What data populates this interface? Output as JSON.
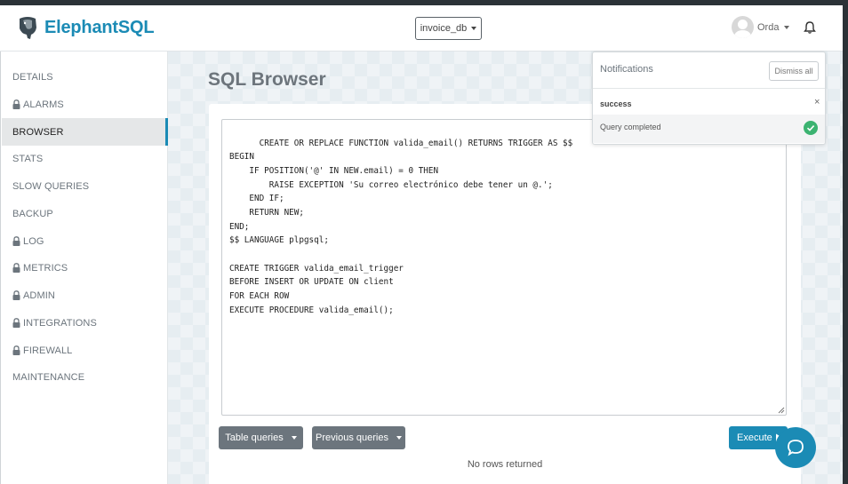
{
  "app": {
    "name": "ElephantSQL"
  },
  "header": {
    "database": "invoice_db",
    "user": "Orda"
  },
  "sidebar": {
    "items": [
      {
        "label": "DETAILS",
        "locked": false,
        "active": false
      },
      {
        "label": "ALARMS",
        "locked": true,
        "active": false
      },
      {
        "label": "BROWSER",
        "locked": false,
        "active": true
      },
      {
        "label": "STATS",
        "locked": false,
        "active": false
      },
      {
        "label": "SLOW QUERIES",
        "locked": false,
        "active": false
      },
      {
        "label": "BACKUP",
        "locked": false,
        "active": false
      },
      {
        "label": "LOG",
        "locked": true,
        "active": false
      },
      {
        "label": "METRICS",
        "locked": true,
        "active": false
      },
      {
        "label": "ADMIN",
        "locked": true,
        "active": false
      },
      {
        "label": "INTEGRATIONS",
        "locked": true,
        "active": false
      },
      {
        "label": "FIREWALL",
        "locked": true,
        "active": false
      },
      {
        "label": "MAINTENANCE",
        "locked": false,
        "active": false
      }
    ]
  },
  "main": {
    "title": "SQL Browser",
    "query": "CREATE OR REPLACE FUNCTION valida_email() RETURNS TRIGGER AS $$\nBEGIN\n    IF POSITION('@' IN NEW.email) = 0 THEN\n        RAISE EXCEPTION 'Su correo electrónico debe tener un @.';\n    END IF;\n    RETURN NEW;\nEND;\n$$ LANGUAGE plpgsql;\n\nCREATE TRIGGER valida_email_trigger\nBEFORE INSERT OR UPDATE ON client\nFOR EACH ROW\nEXECUTE PROCEDURE valida_email();",
    "table_queries_label": "Table queries",
    "previous_queries_label": "Previous queries",
    "execute_label": "Execute",
    "result_text": "No rows returned"
  },
  "notifications": {
    "title": "Notifications",
    "dismiss_label": "Dismiss all",
    "items": [
      {
        "type": "success",
        "message": "Query completed",
        "close": "×"
      }
    ]
  },
  "colors": {
    "brand": "#1b8bb5",
    "active_nav_bg": "#e5e7e8",
    "success": "#3cb371",
    "button_dark": "#6c757d"
  }
}
